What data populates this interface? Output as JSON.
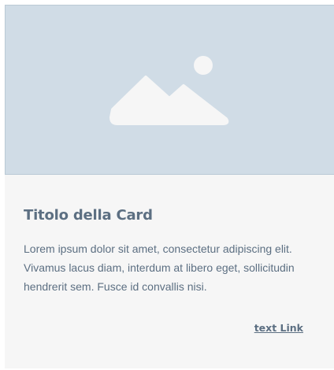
{
  "card": {
    "image_icon": "image-placeholder-icon",
    "title": "Titolo della Card",
    "text": "Lorem ipsum dolor sit amet, consectetur adipiscing elit. Vivamus lacus diam, interdum at libero eget, sollicitudin hendrerit sem. Fusce id convallis nisi.",
    "link_label": "text Link"
  },
  "colors": {
    "image_background": "#d0dce6",
    "icon_fill": "#f6f6f6",
    "text": "#5c6f82",
    "card_background": "#f6f6f6"
  }
}
